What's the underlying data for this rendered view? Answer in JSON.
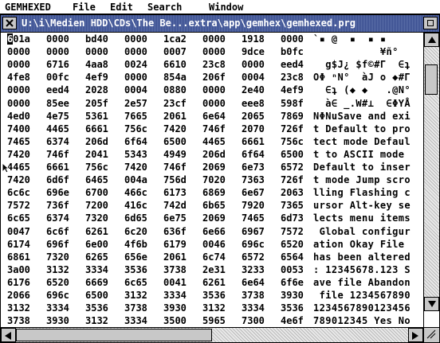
{
  "menubar": {
    "app": "GEMHEXED",
    "items": [
      "File",
      "Edit",
      "Search",
      "Window"
    ]
  },
  "window": {
    "title": "U:\\i\\Medien HDD\\CDs\\The Be...extra\\app\\gemhex\\gemhexed.prg",
    "cursor": {
      "row": 0,
      "col": 0
    }
  },
  "scroll": {
    "vertical_position": 0.08,
    "vertical_thumb_fraction": 0.12,
    "horizontal_position": 0.0,
    "horizontal_thumb_fraction": 0.5
  },
  "hex_rows": [
    {
      "words": [
        "601a",
        "0000",
        "bd40",
        "0000",
        "1ca2",
        "0000",
        "1918",
        "0000"
      ],
      "ascii": "`▪ @  ▪  ▪ ▪"
    },
    {
      "words": [
        "0000",
        "0000",
        "0000",
        "0000",
        "0007",
        "0000",
        "9dce",
        "b0fc"
      ],
      "ascii": "           ¥ñ°"
    },
    {
      "words": [
        "0000",
        "6716",
        "4aa8",
        "0024",
        "6610",
        "23c8",
        "0000",
        "eed4"
      ],
      "ascii": "  g$J¿ $f©#Γ  ∈ʇ"
    },
    {
      "words": [
        "4fe8",
        "00fc",
        "4ef9",
        "0000",
        "854a",
        "206f",
        "0004",
        "23c8"
      ],
      "ascii": "OΦ ⁿN°  àJ o ◆#Γ"
    },
    {
      "words": [
        "0000",
        "eed4",
        "2028",
        "0004",
        "0880",
        "0000",
        "2e40",
        "4ef9"
      ],
      "ascii": "  ∈ʇ (◆ ◆   .@N°"
    },
    {
      "words": [
        "0000",
        "85ee",
        "205f",
        "2e57",
        "23cf",
        "0000",
        "eee8",
        "598f"
      ],
      "ascii": "  à∈ _.W#⊥  ∈ΦYÅ"
    },
    {
      "words": [
        "4ed0",
        "4e75",
        "5361",
        "7665",
        "2061",
        "6e64",
        "2065",
        "7869"
      ],
      "ascii": "NΦNuSave and exi"
    },
    {
      "words": [
        "7400",
        "4465",
        "6661",
        "756c",
        "7420",
        "746f",
        "2070",
        "726f"
      ],
      "ascii": "t Default to pro"
    },
    {
      "words": [
        "7465",
        "6374",
        "206d",
        "6f64",
        "6500",
        "4465",
        "6661",
        "756c"
      ],
      "ascii": "tect mode Defaul"
    },
    {
      "words": [
        "7420",
        "746f",
        "2041",
        "5343",
        "4949",
        "206d",
        "6f64",
        "6500"
      ],
      "ascii": "t to ASCII mode "
    },
    {
      "words": [
        "4465",
        "6661",
        "756c",
        "7420",
        "746f",
        "2069",
        "6e73",
        "6572"
      ],
      "ascii": "Default to inser"
    },
    {
      "words": [
        "7420",
        "6d6f",
        "6465",
        "004a",
        "756d",
        "7020",
        "7363",
        "726f"
      ],
      "ascii": "t mode Jump scro"
    },
    {
      "words": [
        "6c6c",
        "696e",
        "6700",
        "466c",
        "6173",
        "6869",
        "6e67",
        "2063"
      ],
      "ascii": "lling Flashing c"
    },
    {
      "words": [
        "7572",
        "736f",
        "7200",
        "416c",
        "742d",
        "6b65",
        "7920",
        "7365"
      ],
      "ascii": "ursor Alt-key se"
    },
    {
      "words": [
        "6c65",
        "6374",
        "7320",
        "6d65",
        "6e75",
        "2069",
        "7465",
        "6d73"
      ],
      "ascii": "lects menu items"
    },
    {
      "words": [
        "0047",
        "6c6f",
        "6261",
        "6c20",
        "636f",
        "6e66",
        "6967",
        "7572"
      ],
      "ascii": " Global configur"
    },
    {
      "words": [
        "6174",
        "696f",
        "6e00",
        "4f6b",
        "6179",
        "0046",
        "696c",
        "6520"
      ],
      "ascii": "ation Okay File "
    },
    {
      "words": [
        "6861",
        "7320",
        "6265",
        "656e",
        "2061",
        "6c74",
        "6572",
        "6564"
      ],
      "ascii": "has been altered"
    },
    {
      "words": [
        "3a00",
        "3132",
        "3334",
        "3536",
        "3738",
        "2e31",
        "3233",
        "0053"
      ],
      "ascii": ": 12345678.123 S"
    },
    {
      "words": [
        "6176",
        "6520",
        "6669",
        "6c65",
        "0041",
        "6261",
        "6e64",
        "6f6e"
      ],
      "ascii": "ave file Abandon"
    },
    {
      "words": [
        "2066",
        "696c",
        "6500",
        "3132",
        "3334",
        "3536",
        "3738",
        "3930"
      ],
      "ascii": " file 1234567890"
    },
    {
      "words": [
        "3132",
        "3334",
        "3536",
        "3738",
        "3930",
        "3132",
        "3334",
        "3536"
      ],
      "ascii": "1234567890123456"
    },
    {
      "words": [
        "3738",
        "3930",
        "3132",
        "3334",
        "3500",
        "5965",
        "7300",
        "4e6f"
      ],
      "ascii": "789012345 Yes No"
    }
  ]
}
